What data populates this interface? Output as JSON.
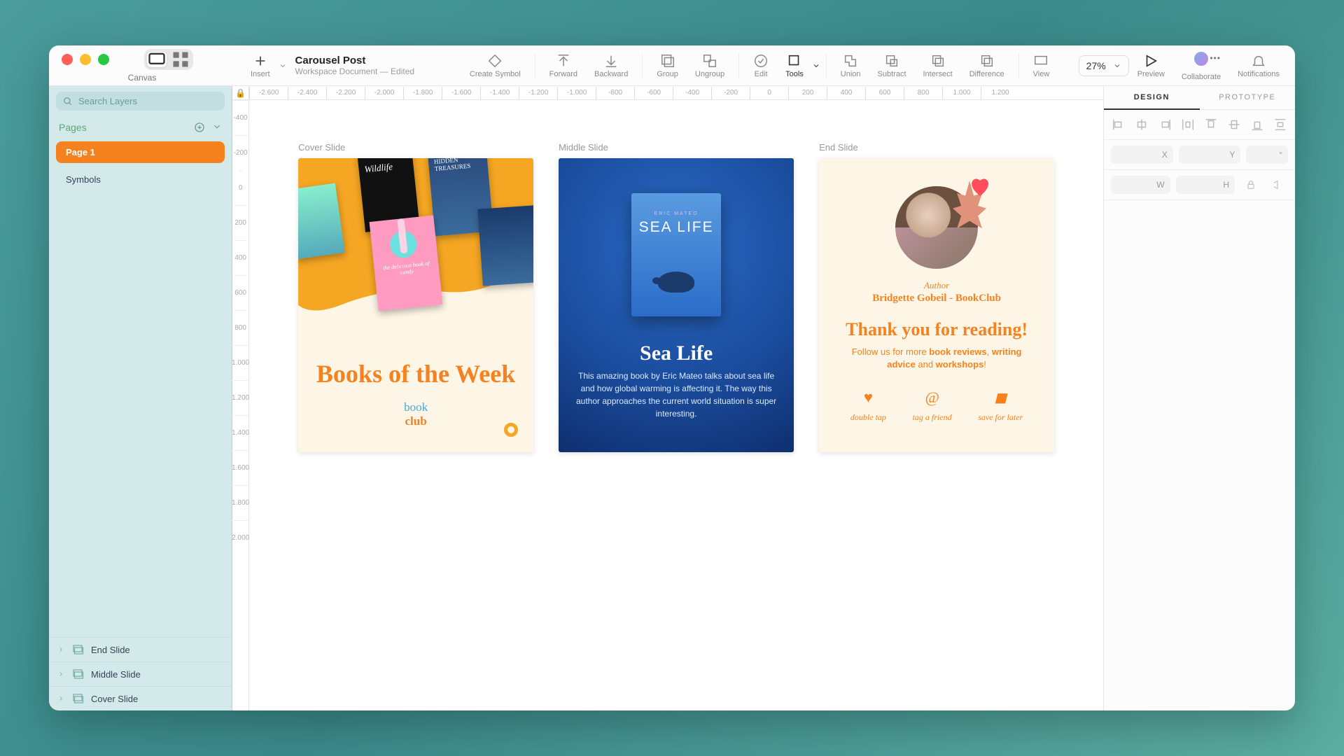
{
  "document": {
    "title": "Carousel Post",
    "subtitle": "Workspace Document — Edited"
  },
  "canvas_label": "Canvas",
  "search_placeholder": "Search Layers",
  "pages_header": "Pages",
  "pages": [
    "Page 1",
    "Symbols"
  ],
  "layers": [
    "End Slide",
    "Middle Slide",
    "Cover Slide"
  ],
  "toolbar": {
    "insert": "Insert",
    "create_symbol": "Create Symbol",
    "forward": "Forward",
    "backward": "Backward",
    "group": "Group",
    "ungroup": "Ungroup",
    "edit": "Edit",
    "tools": "Tools",
    "union": "Union",
    "subtract": "Subtract",
    "intersect": "Intersect",
    "difference": "Difference",
    "view": "View",
    "preview": "Preview",
    "collaborate": "Collaborate",
    "notifications": "Notifications"
  },
  "zoom": "27%",
  "ruler_h": [
    "-2.600",
    "-2.400",
    "-2.200",
    "-2.000",
    "-1.800",
    "-1.600",
    "-1.400",
    "-1.200",
    "-1.000",
    "-800",
    "-600",
    "-400",
    "-200",
    "0",
    "200",
    "400",
    "600",
    "800",
    "1.000",
    "1.200"
  ],
  "ruler_v": [
    "-400",
    "-200",
    "0",
    "200",
    "400",
    "600",
    "800",
    "1.000",
    "1.200",
    "1.400",
    "1.600",
    "1.800",
    "2.000"
  ],
  "artboards": {
    "cover": {
      "name": "Cover Slide",
      "title": "Books of the Week",
      "logo_book": "book",
      "logo_club": "club",
      "book_titles": {
        "b2": "Wildlife",
        "b3": "HIDDEN TREASURES",
        "pink": "the delicious book of candy"
      }
    },
    "middle": {
      "name": "Middle Slide",
      "bc_author": "ERIC MATEO",
      "bc_title": "SEA LIFE",
      "title": "Sea Life",
      "desc": "This amazing book by Eric Mateo talks about sea life and how global warming is affecting it. The way this author approaches the current world situation is super interesting."
    },
    "end": {
      "name": "End Slide",
      "role": "Author",
      "author": "Bridgette Gobeil - BookClub",
      "thanks": "Thank you for reading!",
      "follow_pre": "Follow us for more ",
      "follow_b1": "book reviews",
      "follow_mid": ", ",
      "follow_b2": "writing advice",
      "follow_and": " and ",
      "follow_b3": "workshops",
      "follow_end": "!",
      "actions": [
        "double tap",
        "tag a friend",
        "save for later"
      ]
    }
  },
  "inspector": {
    "tab_design": "DESIGN",
    "tab_prototype": "PROTOTYPE",
    "x": "X",
    "y": "Y",
    "deg": "°",
    "w": "W",
    "h": "H"
  }
}
